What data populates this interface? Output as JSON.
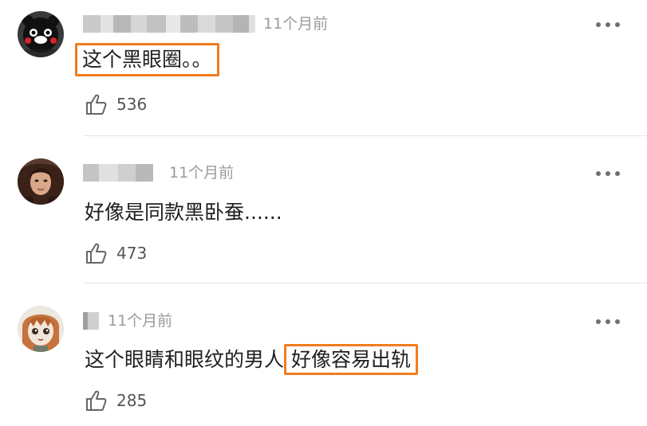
{
  "comments": [
    {
      "time": "11个月前",
      "text": "这个黑眼圈。。",
      "likes": "536",
      "avatar": "kumamon-avatar"
    },
    {
      "time": "11个月前",
      "text": "好像是同款黑卧蚕......",
      "likes": "473",
      "avatar": "woman-portrait-avatar"
    },
    {
      "time": "11个月前",
      "text_prefix": "这个眼睛和眼纹的男人",
      "text_highlight": "好像容易出轨",
      "likes": "285",
      "avatar": "anime-girl-avatar"
    }
  ],
  "colors": {
    "highlight": "#f07d1f",
    "timestamp": "#9a9a9a",
    "text": "#1f1f1f"
  },
  "icons": [
    "thumbs-up-icon",
    "more-icon"
  ]
}
